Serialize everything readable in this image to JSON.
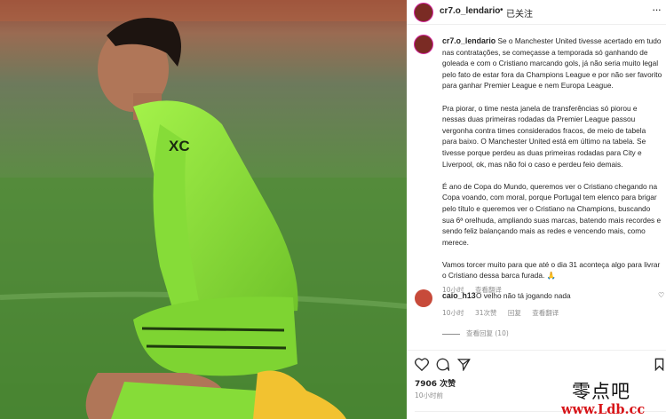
{
  "post": {
    "username": "cr7.o_lendario",
    "separator": "•",
    "follow_label": "已关注",
    "more_label": "···",
    "caption_paragraphs": [
      "Se o Manchester United tivesse acertado em tudo nas contratações, se começasse a temporada só ganhando de goleada e com o Cristiano marcando gols, já não seria muito legal pelo fato de estar fora da Champions League e por não ser favorito para ganhar Premier League e nem Europa League.",
      "Pra piorar, o time nesta janela de transferências só piorou e nessas duas primeiras rodadas da Premier League passou vergonha contra times considerados fracos, de meio de tabela para baixo. O Manchester United está em último na tabela. Se tivesse porque perdeu as duas primeiras rodadas para City e Liverpool, ok, mas não foi o caso e perdeu feio demais.",
      "É ano de Copa do Mundo, queremos ver o Cristiano chegando na Copa voando, com moral, porque Portugal tem elenco para brigar pelo título e queremos ver o Cristiano na Champions, buscando sua 6ª orelhuda, ampliando suas marcas, batendo mais recordes e sendo feliz balançando mais as redes e vencendo mais, como merece.",
      "Vamos torcer muito para que até o dia 31 aconteça algo para livrar o Cristiano dessa barca furada. 🙏"
    ],
    "caption_time": "10小时",
    "caption_translate": "查看翻译",
    "comment": {
      "username": "caio_h13",
      "text": "O velho não tá jogando nada",
      "time": "10小时",
      "likes": "31次赞",
      "reply": "回复",
      "translate": "查看翻译",
      "view_replies": "查看回复 (10)"
    },
    "likes_count": "7906 次赞",
    "post_time": "10小时前"
  },
  "icons": {
    "like": "heart-icon",
    "comment": "comment-icon",
    "share": "share-icon",
    "save": "bookmark-icon"
  },
  "watermark": {
    "line1": "零点吧",
    "line2": "www.Ldb.cc"
  },
  "colors": {
    "kit_green": "#8fe43a",
    "pitch_green": "#4f8a34",
    "story_ring": "#d6249f",
    "meta_gray": "#8e8e8e",
    "watermark_red": "#d71418"
  }
}
